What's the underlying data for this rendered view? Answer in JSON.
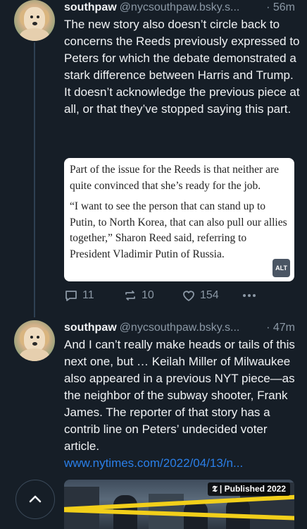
{
  "posts": [
    {
      "author": "southpaw",
      "handle": "@nycsouthpaw.bsky.s...",
      "time": "· 56m",
      "text": "The new story also doesn’t circle back to concerns the Reeds previously expressed to Peters for which the debate demonstrated a stark difference between Harris and Trump. It doesn’t acknowledge the previous piece at all, or that they’ve stopped saying this part.",
      "image": {
        "para1": "Part of the issue for the Reeds is that neither are quite convinced that she’s ready for the job.",
        "para2": "“I want to see the person that can stand up to Putin, to North Korea, that can also pull our allies together,” Sharon Reed said, referring to President Vladimir Putin of Russia.",
        "alt_badge": "ALT"
      },
      "replies": "11",
      "reposts": "10",
      "likes": "154"
    },
    {
      "author": "southpaw",
      "handle": "@nycsouthpaw.bsky.s...",
      "time": "· 47m",
      "text": "And I can’t really make heads or tails of this next one, but … Keilah Miller of Milwaukee also appeared in a previous NYT piece—as the neighbor of the subway shooter, Frank James. The reporter of that story has a contrib line on Peters’ undecided voter article.",
      "link": "www.nytimes.com/2022/04/13/n...",
      "thumb_badge": "𝕿 | Published 2022"
    }
  ],
  "colors": {
    "background": "#161e27",
    "link": "#2a7fe8",
    "muted": "#8b98a5"
  }
}
